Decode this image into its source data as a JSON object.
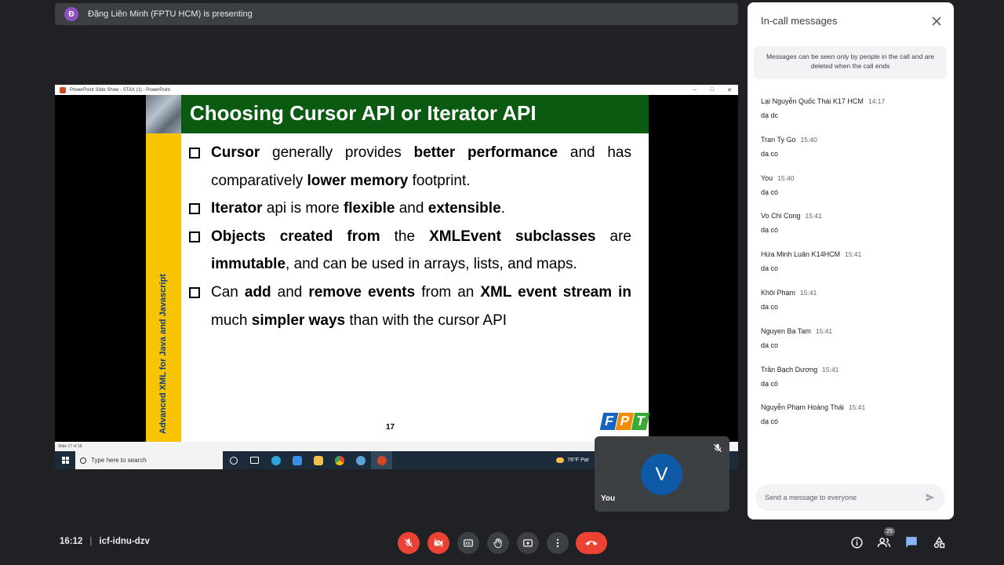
{
  "banner": {
    "avatar_letter": "Đ",
    "text": "Đặng Liên Minh (FPTU HCM) is presenting"
  },
  "screen": {
    "window_title": "PowerPoint Slide Show  -  STAX (1)  -  PowerPoint",
    "window_buttons": [
      "–",
      "□",
      "✕"
    ],
    "slide": {
      "title": "Choosing Cursor API or Iterator API",
      "vertical_text": "Advanced XML for Java and Javascript",
      "page_number": "17",
      "logo_letters": [
        "F",
        "P",
        "T"
      ],
      "bullets": [
        [
          {
            "t": "Cursor",
            "b": true
          },
          {
            "t": " generally provides ",
            "b": false
          },
          {
            "t": "better performance",
            "b": true
          },
          {
            "t": " and has comparatively ",
            "b": false
          },
          {
            "t": "lower memory",
            "b": true
          },
          {
            "t": " footprint.",
            "b": false
          }
        ],
        [
          {
            "t": "Iterator",
            "b": true
          },
          {
            "t": " api is more ",
            "b": false
          },
          {
            "t": "flexible",
            "b": true
          },
          {
            "t": " and ",
            "b": false
          },
          {
            "t": "extensible",
            "b": true
          },
          {
            "t": ".",
            "b": false
          }
        ],
        [
          {
            "t": "Objects created from",
            "b": true
          },
          {
            "t": " the ",
            "b": false
          },
          {
            "t": "XMLEvent subclasses",
            "b": true
          },
          {
            "t": " are ",
            "b": false
          },
          {
            "t": "immutable",
            "b": true
          },
          {
            "t": ", and can be used in arrays, lists, and maps.",
            "b": false
          }
        ],
        [
          {
            "t": "Can ",
            "b": false
          },
          {
            "t": "add",
            "b": true
          },
          {
            "t": " and ",
            "b": false
          },
          {
            "t": "remove events",
            "b": true
          },
          {
            "t": " from an ",
            "b": false
          },
          {
            "t": "XML event stream in",
            "b": true
          },
          {
            "t": " much ",
            "b": false
          },
          {
            "t": "simpler ways",
            "b": true
          },
          {
            "t": " than with the cursor API",
            "b": false
          }
        ]
      ]
    },
    "status_bar": "Slide 17 of 18",
    "taskbar": {
      "search_placeholder": "Type here to search",
      "weather": "76°F  Par"
    }
  },
  "self_view": {
    "avatar_letter": "V",
    "label": "You"
  },
  "chat": {
    "title": "In-call messages",
    "notice": "Messages can be seen only by people in the call and are deleted when the call ends",
    "messages": [
      {
        "sender": "Lại Nguyễn Quốc Thái K17 HCM",
        "time": "14:17",
        "text": "dạ dc"
      },
      {
        "sender": "Tran Ty Go",
        "time": "15:40",
        "text": "da co"
      },
      {
        "sender": "You",
        "time": "15:40",
        "text": "dạ có"
      },
      {
        "sender": "Vo Chi Cong",
        "time": "15:41",
        "text": "dạ có"
      },
      {
        "sender": "Hứa Minh Luân K14HCM",
        "time": "15:41",
        "text": "da co"
      },
      {
        "sender": "Khôi Phạm",
        "time": "15:41",
        "text": "da co"
      },
      {
        "sender": "Nguyen Ba Tam",
        "time": "15:41",
        "text": "da co"
      },
      {
        "sender": "Trần Bạch Dương",
        "time": "15:41",
        "text": "dạ có"
      },
      {
        "sender": "Nguyễn Phạm Hoàng Thái",
        "time": "15:41",
        "text": "dạ có"
      }
    ],
    "input_placeholder": "Send a message to everyone"
  },
  "bottom": {
    "time": "16:12",
    "separator": "|",
    "meeting_code": "icf-idnu-dzv",
    "participant_count": "29"
  },
  "colors": {
    "slide_title_bg": "#0a5a12",
    "slide_sidebar": "#f8c400",
    "end_call": "#ea4335",
    "chat_icon": "#8ab4f8"
  }
}
